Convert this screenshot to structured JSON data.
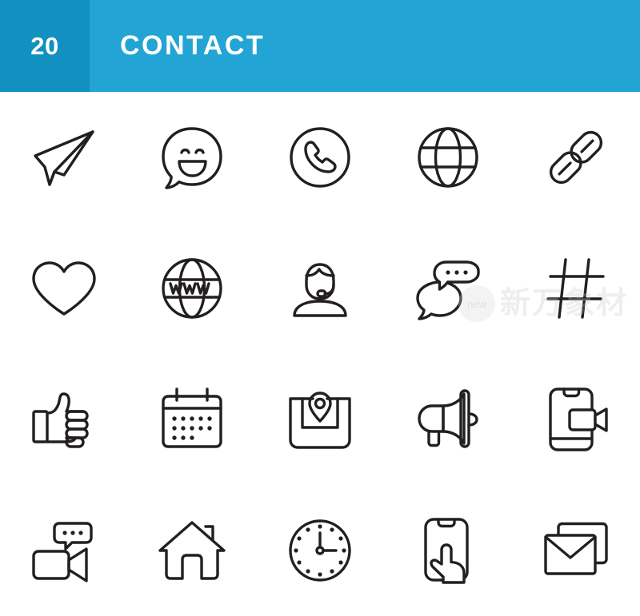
{
  "header": {
    "badge_number": "20",
    "title": "CONTACT",
    "badge_color": "#1290c0",
    "bar_color": "#22a5d4",
    "text_color": "#ffffff"
  },
  "icons": {
    "stroke_color": "#231f20",
    "columns": 5,
    "rows": 4,
    "items": [
      {
        "id": "paper-plane",
        "label": "Paper Plane Send"
      },
      {
        "id": "smiley-chat-bubble",
        "label": "Smiling Face Speech Bubble"
      },
      {
        "id": "phone-circle",
        "label": "Phone Call"
      },
      {
        "id": "globe",
        "label": "Globe Internet"
      },
      {
        "id": "chain-link",
        "label": "Link Chain"
      },
      {
        "id": "heart",
        "label": "Heart Like"
      },
      {
        "id": "www-globe",
        "label": "WWW Globe Website"
      },
      {
        "id": "support-agent",
        "label": "Customer Support Headset"
      },
      {
        "id": "chat-bubbles",
        "label": "Chat Bubbles Messages"
      },
      {
        "id": "hashtag",
        "label": "Hashtag"
      },
      {
        "id": "thumbs-up",
        "label": "Thumbs Up Like"
      },
      {
        "id": "calendar",
        "label": "Calendar Schedule"
      },
      {
        "id": "map-pin",
        "label": "Map Location Pin"
      },
      {
        "id": "megaphone",
        "label": "Megaphone Announcement"
      },
      {
        "id": "smartphone-video",
        "label": "Smartphone Video Call"
      },
      {
        "id": "video-camera-chat",
        "label": "Video Camera Chat"
      },
      {
        "id": "home",
        "label": "Home House"
      },
      {
        "id": "clock",
        "label": "Clock Time"
      },
      {
        "id": "smartphone-touch",
        "label": "Smartphone Touch Tap"
      },
      {
        "id": "envelope-mail",
        "label": "Envelope Mail"
      }
    ]
  },
  "watermark": {
    "badge_text": "new",
    "text": "新万象材"
  }
}
